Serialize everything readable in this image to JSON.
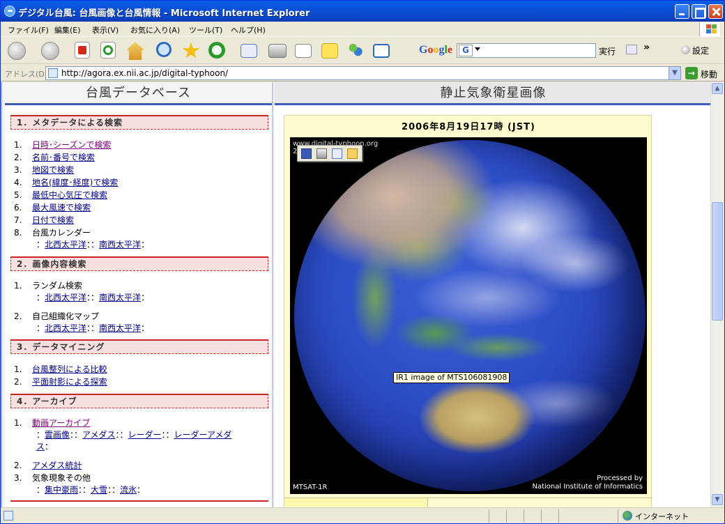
{
  "window": {
    "title": "デジタル台風: 台風画像と台風情報 - Microsoft Internet Explorer"
  },
  "menu": [
    "ファイル(F)",
    "編集(E)",
    "表示(V)",
    "お気に入り(A)",
    "ツール(T)",
    "ヘルプ(H)"
  ],
  "toolbar": {
    "google_label": "Google",
    "google_g": "G",
    "search_value": "",
    "go_label": "実行",
    "more": "»",
    "settings_label": "設定"
  },
  "address": {
    "label": "アドレス(D)",
    "url": "http://agora.ex.nii.ac.jp/digital-typhoon/",
    "go_label": "移動"
  },
  "left": {
    "header": "台風データベース",
    "sections": [
      {
        "title": "1．メタデータによる検索"
      },
      {
        "title": "2．画像内容検索"
      },
      {
        "title": "3．データマイニング"
      },
      {
        "title": "4．アーカイブ"
      }
    ],
    "meta_items": [
      {
        "num": "1.",
        "label": "日時･シーズンで検索"
      },
      {
        "num": "2.",
        "label": "名前･番号で検索"
      },
      {
        "num": "3.",
        "label": "地図で検索"
      },
      {
        "num": "4.",
        "label": "地名(緯度･経度)で検索"
      },
      {
        "num": "5.",
        "label": "最低中心気圧で検索"
      },
      {
        "num": "6.",
        "label": "最大風速で検索"
      },
      {
        "num": "7.",
        "label": "日付で検索"
      },
      {
        "num": "8.",
        "label": "台風カレンダー"
      }
    ],
    "calendar_links": [
      "北西太平洋",
      "南西太平洋"
    ],
    "image_items": [
      {
        "num": "1.",
        "label": "ランダム検索",
        "links": [
          "北西太平洋",
          "南西太平洋"
        ]
      },
      {
        "num": "2.",
        "label": "自己組織化マップ",
        "links": [
          "北西太平洋",
          "南西太平洋"
        ]
      }
    ],
    "mining_items": [
      {
        "num": "1.",
        "label": "台風整列による比較"
      },
      {
        "num": "2.",
        "label": "平面射影による探索"
      }
    ],
    "archive_items": [
      {
        "num": "1.",
        "label": "動画アーカイブ",
        "links": [
          "雲画像",
          "アメダス",
          "レーダー",
          "レーダーアメダ",
          "ス"
        ]
      },
      {
        "num": "2.",
        "label": "アメダス統計"
      },
      {
        "num": "3.",
        "label": "気象現象その他",
        "links": [
          "集中豪雨",
          "大雪",
          "流氷"
        ]
      }
    ],
    "sep": "：",
    "sepd": "：："
  },
  "right": {
    "header": "静止気象衛星画像",
    "date": "2006年8月19日17時 (JST)",
    "caption_top_1": "www.digital-typhoon.org",
    "caption_top_2": "2                    C",
    "caption_bl": "MTSAT-1R",
    "caption_br_1": "Processed by",
    "caption_br_2": "National Institute of Informatics",
    "tooltip": "IR1 image of MTS106081908"
  },
  "status": {
    "zone": "インターネット"
  },
  "colors": {
    "link": "#00008b",
    "visited": "#800080",
    "section_border": "#cc2222",
    "header_rule": "#3a5fb8"
  }
}
